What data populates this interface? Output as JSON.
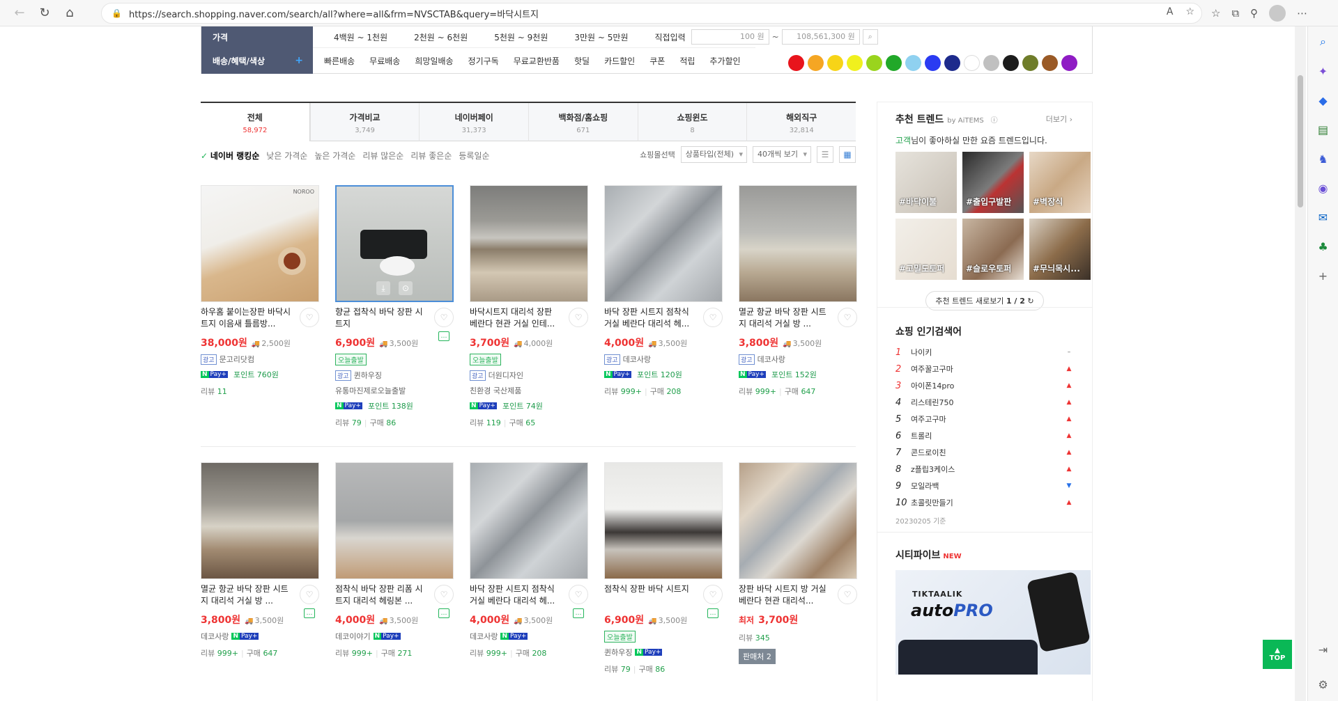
{
  "browser": {
    "url": "https://search.shopping.naver.com/search/all?where=all&frm=NVSCTAB&query=바닥시트지"
  },
  "filter": {
    "price_label": "가격",
    "price_ranges": [
      "4백원 ~ 1천원",
      "2천원 ~ 6천원",
      "5천원 ~ 9천원",
      "3만원 ~ 5만원"
    ],
    "direct_input_label": "직접입력",
    "price_min_placeholder": "100 원",
    "price_max_placeholder": "108,561,300 원",
    "benefit_label": "배송/혜택/색상",
    "benefits": [
      "빠른배송",
      "무료배송",
      "희망일배송",
      "정기구독",
      "무료교환반품",
      "핫딜",
      "카드할인",
      "쿠폰",
      "적립",
      "추가할인"
    ],
    "colors": [
      "#e8141c",
      "#f5a623",
      "#f7d417",
      "#f0f01e",
      "#9ad41d",
      "#21a829",
      "#8fd1f0",
      "#2a3bf2",
      "#1d2a8c",
      "#ffffff",
      "#c0c0c0",
      "#1c1c1c",
      "#6f7d2a",
      "#9a5a26",
      "#8f1cc4"
    ]
  },
  "tabs": [
    {
      "name": "전체",
      "count": "58,972"
    },
    {
      "name": "가격비교",
      "count": "3,749"
    },
    {
      "name": "네이버페이",
      "count": "31,373"
    },
    {
      "name": "백화점/홈쇼핑",
      "count": "671"
    },
    {
      "name": "쇼핑윈도",
      "count": "8"
    },
    {
      "name": "해외직구",
      "count": "32,814"
    }
  ],
  "sort": {
    "items": [
      "네이버 랭킹순",
      "낮은 가격순",
      "높은 가격순",
      "리뷰 많은순",
      "리뷰 좋은순",
      "등록일순"
    ],
    "mall_select": "쇼핑몰선택",
    "type_select": "상품타입(전체)",
    "view_count": "40개씩 보기"
  },
  "products": [
    {
      "title": "하우홈 붙이는장판 바닥시트지 이음새 틀름방...",
      "price": "38,000원",
      "ship": "2,500원",
      "ad": "광고",
      "seller": "문고리닷컴",
      "points": "포인트 760원",
      "review": "11",
      "buy": ""
    },
    {
      "title": "향균 접착식 바닥 장판 시트지",
      "price": "6,900원",
      "ship": "3,500원",
      "tomorrow": "오늘출발",
      "ad": "광고",
      "seller": "퀸하우징",
      "sub": "유통마진제로오늘출발",
      "points": "포인트 138원",
      "review": "79",
      "buy": "86"
    },
    {
      "title": "바닥시트지 대리석 장판 베란다 현관 거실 인테...",
      "price": "3,700원",
      "ship": "4,000원",
      "tomorrow": "오늘출발",
      "ad": "광고",
      "seller": "더원디자인",
      "sub": "친환경 국산제품",
      "points": "포인트 74원",
      "review": "119",
      "buy": "65"
    },
    {
      "title": "바닥 장판 시트지 점착식 거실 베란다 대리석 헤...",
      "price": "4,000원",
      "ship": "3,500원",
      "ad": "광고",
      "seller": "데코사랑",
      "points": "포인트 120원",
      "review": "999+",
      "buy": "208"
    },
    {
      "title": "멸균 항균 바닥 장판 시트지 대리석 거실 방 ...",
      "price": "3,800원",
      "ship": "3,500원",
      "ad": "광고",
      "seller": "데코사랑",
      "points": "포인트 152원",
      "review": "999+",
      "buy": "647"
    },
    {
      "title": "멸균 항균 바닥 장판 시트지 대리석 거실 방 ...",
      "price": "3,800원",
      "ship": "3,500원",
      "seller": "데코사랑",
      "review": "999+",
      "buy": "647"
    },
    {
      "title": "점착식 바닥 장판 리폼 시트지 대리석 헤링본 ...",
      "price": "4,000원",
      "ship": "3,500원",
      "seller": "데코이야기",
      "review": "999+",
      "buy": "271"
    },
    {
      "title": "바닥 장판 시트지 점착식 거실 베란다 대리석 헤...",
      "price": "4,000원",
      "ship": "3,500원",
      "seller": "데코사랑",
      "review": "999+",
      "buy": "208"
    },
    {
      "title": "점착식 장판 바닥 시트지",
      "price": "6,900원",
      "ship": "3,500원",
      "tomorrow": "오늘출발",
      "seller": "퀸하우징",
      "review": "79",
      "buy": "86"
    },
    {
      "title": "장판 바닥 시트지 방 거실 베란다 현관 대리석...",
      "price_prefix": "최저",
      "price": "3,700원",
      "review": "345",
      "seller_count": "판매처 2"
    }
  ],
  "labels": {
    "review": "리뷰",
    "buy": "구매",
    "ad": "광고"
  },
  "trends": {
    "title": "추천 트렌드",
    "by": "by AiTEMS",
    "more": "더보기",
    "desc_hl": "고객",
    "desc": "님이 좋아하실 만한 요즘 트렌드입니다.",
    "tags": [
      "#바닥이불",
      "#출입구발판",
      "#벽장식",
      "#고밀도토퍼",
      "#슬로우토퍼",
      "#무늬목시..."
    ],
    "refresh": "추천 트렌드 새로보기",
    "page": "1 / 2"
  },
  "popular": {
    "title": "쇼핑 인기검색어",
    "items": [
      {
        "rank": "1",
        "kw": "나이키",
        "trend": "same"
      },
      {
        "rank": "2",
        "kw": "여주꿀고구마",
        "trend": "up"
      },
      {
        "rank": "3",
        "kw": "아이폰14pro",
        "trend": "up"
      },
      {
        "rank": "4",
        "kw": "리스테린750",
        "trend": "up"
      },
      {
        "rank": "5",
        "kw": "여주고구마",
        "trend": "up"
      },
      {
        "rank": "6",
        "kw": "트롤리",
        "trend": "up"
      },
      {
        "rank": "7",
        "kw": "콘드로이친",
        "trend": "up"
      },
      {
        "rank": "8",
        "kw": "z플립3케이스",
        "trend": "up"
      },
      {
        "rank": "9",
        "kw": "모일라백",
        "trend": "down"
      },
      {
        "rank": "10",
        "kw": "초콜릿만들기",
        "trend": "up"
      }
    ],
    "date": "20230205 기준"
  },
  "cityfive": {
    "title": "시티파이브",
    "new": "NEW",
    "brand": "TIKTAALIK",
    "product": "auto",
    "product_pro": "PRO"
  },
  "top_button": "TOP"
}
